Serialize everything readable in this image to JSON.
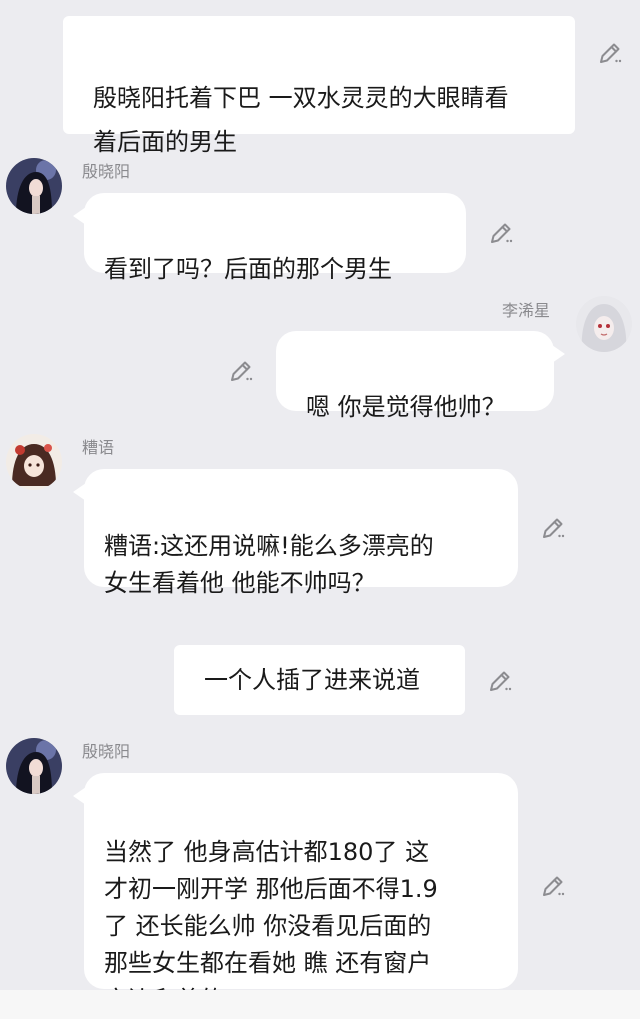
{
  "messages": [
    {
      "type": "narration",
      "text": "殷晓阳托着下巴 一双水灵灵的大眼睛看\n着后面的男生"
    },
    {
      "type": "chat-left",
      "sender": "殷晓阳",
      "avatar": "girl-dark-hair-avatar",
      "text": "看到了吗？后面的那个男生"
    },
    {
      "type": "chat-right",
      "sender": "李浠星",
      "avatar": "white-hair-avatar",
      "text": "嗯 你是觉得他帅？"
    },
    {
      "type": "chat-left",
      "sender": "糟语",
      "avatar": "girl-flower-avatar",
      "text": "糟语:这还用说嘛!能么多漂亮的\n女生看着他 他能不帅吗？"
    },
    {
      "type": "narration",
      "text": "一个人插了进来说道"
    },
    {
      "type": "chat-left",
      "sender": "殷晓阳",
      "avatar": "girl-dark-hair-avatar",
      "text": "当然了 他身高估计都180了 这\n才初一刚开学 那他后面不得1.9\n了 还长能么帅 你没看见后面的\n那些女生都在看她 瞧 还有窗户\n旁边爬着的"
    }
  ],
  "icons": {
    "edit": "edit-pen-icon"
  },
  "colors": {
    "background": "#ececf0",
    "bubble": "#ffffff",
    "name_text": "#8a8a8e",
    "message_text": "#1a1a1a"
  }
}
